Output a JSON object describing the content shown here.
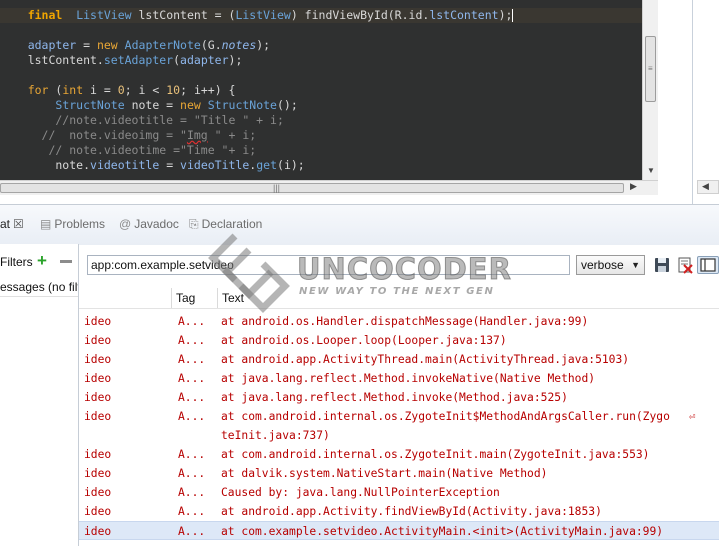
{
  "editor": {
    "lines": [
      "final ListView lstContent = (ListView) findViewById(R.id.lstContent);",
      "adapter = new AdapterNote(G.notes);",
      "lstContent.setAdapter(adapter);",
      "for (int i = 0; i < 10; i++) {",
      "StructNote note = new StructNote();",
      "//note.videotitle = \"Title \" + i;",
      "//  note.videoimg = \"Img \" + i;",
      "// note.videotime =\"Time \"+ i;",
      "note.videotitle = videoTitle.get(i);"
    ]
  },
  "tabs": {
    "logcat": "at",
    "problems": "Problems",
    "javadoc": "Javadoc",
    "declaration": "Declaration"
  },
  "filters": {
    "label": "Filters",
    "item": "essages (no filt"
  },
  "toolbar": {
    "search_value": "app:com.example.setvideo",
    "level": "verbose"
  },
  "log": {
    "columns": {
      "tag": "Tag",
      "text": "Text"
    },
    "rows": [
      {
        "app": "ideo",
        "tag": "A...",
        "text": "at android.os.Handler.dispatchMessage(Handler.java:99)"
      },
      {
        "app": "ideo",
        "tag": "A...",
        "text": "at android.os.Looper.loop(Looper.java:137)"
      },
      {
        "app": "ideo",
        "tag": "A...",
        "text": "at android.app.ActivityThread.main(ActivityThread.java:5103)"
      },
      {
        "app": "ideo",
        "tag": "A...",
        "text": "at java.lang.reflect.Method.invokeNative(Native Method)"
      },
      {
        "app": "ideo",
        "tag": "A...",
        "text": "at java.lang.reflect.Method.invoke(Method.java:525)"
      },
      {
        "app": "ideo",
        "tag": "A...",
        "text": "at com.android.internal.os.ZygoteInit$MethodAndArgsCaller.run(Zygo"
      },
      {
        "app": "",
        "tag": "",
        "text": "teInit.java:737)"
      },
      {
        "app": "ideo",
        "tag": "A...",
        "text": "at com.android.internal.os.ZygoteInit.main(ZygoteInit.java:553)"
      },
      {
        "app": "ideo",
        "tag": "A...",
        "text": "at dalvik.system.NativeStart.main(Native Method)"
      },
      {
        "app": "ideo",
        "tag": "A...",
        "text": "Caused by: java.lang.NullPointerException"
      },
      {
        "app": "ideo",
        "tag": "A...",
        "text": "at android.app.Activity.findViewById(Activity.java:1853)"
      },
      {
        "app": "ideo",
        "tag": "A...",
        "text": "at com.example.setvideo.ActivityMain.<init>(ActivityMain.java:99)"
      }
    ],
    "selected_row": 11
  },
  "watermark": {
    "title": "UNCOCODER",
    "subtitle": "NEW WAY TO THE NEXT GEN"
  },
  "colors": {
    "editor_bg": "#2f3030",
    "keyword": "#f0a500",
    "type": "#6aa3d8",
    "log_error": "#b70000",
    "selection": "#dde8f7"
  },
  "icons": {
    "close": "close-icon",
    "problems": "problems-icon",
    "javadoc": "javadoc-icon",
    "declaration": "declaration-icon",
    "add": "add-icon",
    "remove": "remove-icon",
    "save": "save-icon",
    "clear": "clear-log-icon",
    "toggle": "toggle-panel-icon"
  }
}
